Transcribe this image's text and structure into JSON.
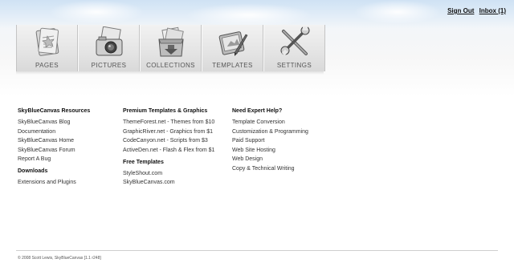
{
  "header": {
    "sign_out": "Sign Out",
    "inbox": "Inbox (1)"
  },
  "nav": {
    "tabs": [
      {
        "label": "Pages",
        "icon": "pages-icon"
      },
      {
        "label": "Pictures",
        "icon": "camera-icon"
      },
      {
        "label": "Collections",
        "icon": "collections-box-icon"
      },
      {
        "label": "Templates",
        "icon": "templates-icon"
      },
      {
        "label": "Settings",
        "icon": "tools-icon"
      }
    ]
  },
  "footer_links": {
    "resources": {
      "heading": "SkyBlueCanvas Resources",
      "items": [
        "SkyBlueCanvas Blog",
        "Documentation",
        "SkyBlueCanvas Home",
        "SkyBlueCanvas Forum",
        "Report A Bug"
      ]
    },
    "downloads": {
      "heading": "Downloads",
      "items": [
        "Extensions and Plugins"
      ]
    },
    "premium": {
      "heading": "Premium Templates & Graphics",
      "items": [
        "ThemeForest.net - Themes from $10",
        "GraphicRiver.net - Graphics from $1",
        "CodeCanyon.net - Scripts from $3",
        "ActiveDen.net - Flash & Flex from $1"
      ]
    },
    "free": {
      "heading": "Free Templates",
      "items": [
        "StyleShout.com",
        "SkyBlueCanvas.com"
      ]
    },
    "help": {
      "heading": "Need Expert Help?",
      "items": [
        "Template Conversion",
        "Customization & Programming",
        "Paid Support",
        "Web Site Hosting",
        "Web Design",
        "Copy & Technical Writing"
      ]
    }
  },
  "footer": {
    "copyright": "© 2008 Scott Lewis, SkyBlueCanvas [1.1 r248]"
  }
}
